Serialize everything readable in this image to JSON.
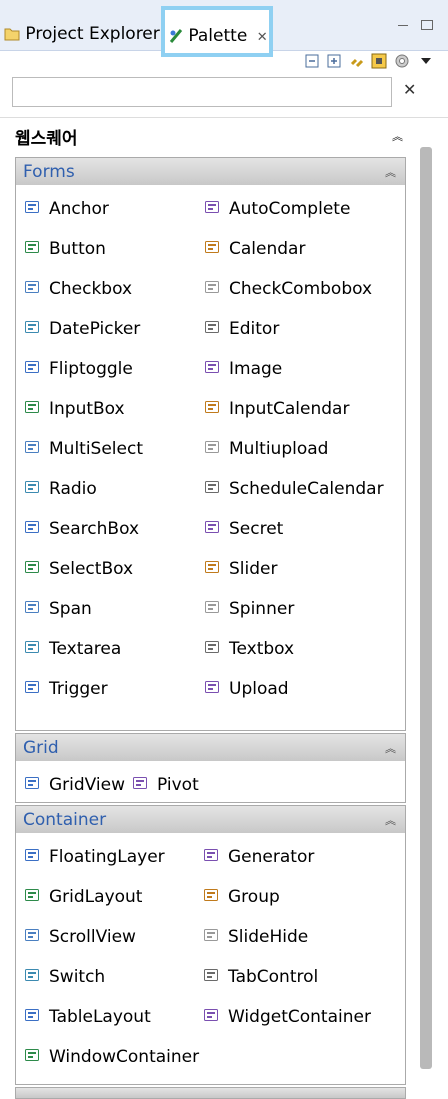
{
  "tabs": {
    "project_explorer": "Project Explorer",
    "palette": "Palette",
    "close_glyph": "✕"
  },
  "search": {
    "value": "",
    "placeholder": "",
    "clear_glyph": "✕"
  },
  "palette_group": "웹스퀘어",
  "drawers": {
    "forms": {
      "label": "Forms",
      "items": [
        "Anchor",
        "AutoComplete",
        "Button",
        "Calendar",
        "Checkbox",
        "CheckCombobox",
        "DatePicker",
        "Editor",
        "Fliptoggle",
        "Image",
        "InputBox",
        "InputCalendar",
        "MultiSelect",
        "Multiupload",
        "Radio",
        "ScheduleCalendar",
        "SearchBox",
        "Secret",
        "SelectBox",
        "Slider",
        "Span",
        "Spinner",
        "Textarea",
        "Textbox",
        "Trigger",
        "Upload"
      ]
    },
    "grid": {
      "label": "Grid",
      "items": [
        "GridView",
        "Pivot"
      ]
    },
    "container": {
      "label": "Container",
      "items": [
        "FloatingLayer",
        "Generator",
        "GridLayout",
        "Group",
        "ScrollView",
        "SlideHide",
        "Switch",
        "TabControl",
        "TableLayout",
        "WidgetContainer",
        "WindowContainer"
      ]
    }
  },
  "colors": {
    "accent": "#2f5fae",
    "tab_highlight": "#8fd0f2",
    "header_bg": "#d6d6d6"
  }
}
